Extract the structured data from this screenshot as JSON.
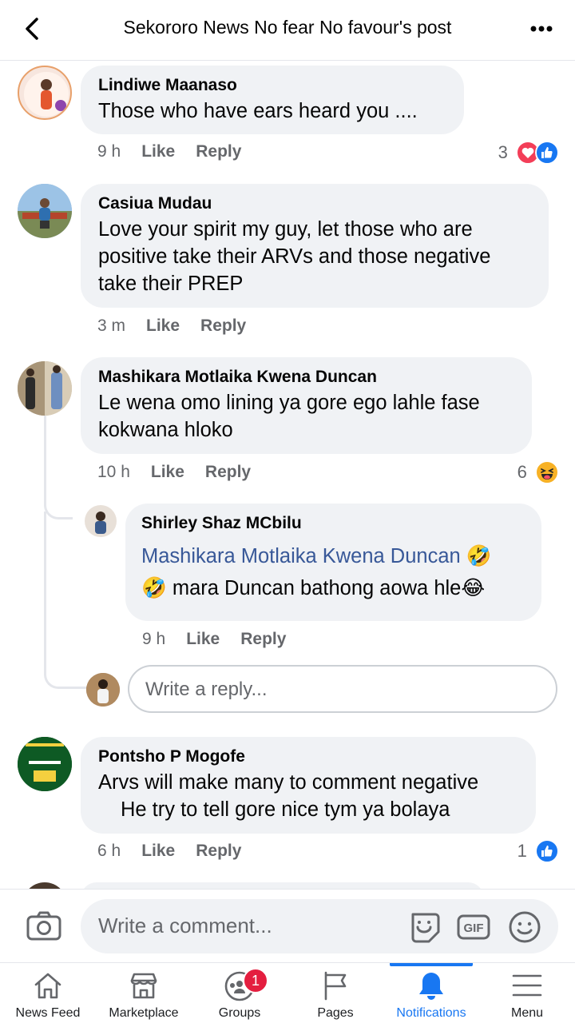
{
  "header": {
    "title": "Sekororo News No fear No favour's post"
  },
  "comments": [
    {
      "name": "Lindiwe Maanaso",
      "text": "Those who have ears heard you ....",
      "time": "9 h",
      "like": "Like",
      "reply": "Reply",
      "reactions": "3"
    },
    {
      "name": "Casiua Mudau",
      "text": "Love your spirit my guy, let those who are positive take their ARVs and those negative take their PREP",
      "time": "3 m",
      "like": "Like",
      "reply": "Reply"
    },
    {
      "name": "Mashikara Motlaika Kwena Duncan",
      "text": "Le wena omo lining ya gore ego lahle fase kokwana hloko",
      "time": "10 h",
      "like": "Like",
      "reply": "Reply",
      "reactions": "6"
    },
    {
      "name": "Pontsho P Mogofe",
      "text_line1": "Arvs will make many to comment negative",
      "text_line2": "He try to tell gore nice tym ya bolaya",
      "time": "6 h",
      "like": "Like",
      "reply": "Reply",
      "reactions": "1"
    }
  ],
  "nested_reply": {
    "name": "Shirley Shaz MCbilu",
    "mention": "Mashikara Motlaika Kwena Duncan",
    "emoji1": "🤣",
    "emoji2": "🤣",
    "text": " mara Duncan bathong aowa hle",
    "emoji3": "😂",
    "time": "9 h",
    "like": "Like",
    "reply": "Reply"
  },
  "reply_input": {
    "placeholder": "Write a reply..."
  },
  "composer": {
    "placeholder": "Write a comment..."
  },
  "nav": {
    "tabs": [
      {
        "label": "News Feed"
      },
      {
        "label": "Marketplace"
      },
      {
        "label": "Groups",
        "badge": "1"
      },
      {
        "label": "Pages"
      },
      {
        "label": "Notifications"
      },
      {
        "label": "Menu"
      }
    ]
  },
  "colors": {
    "brand": "#1877f2",
    "bubble": "#f0f2f5",
    "love": "#f33e58",
    "mention": "#385898"
  }
}
